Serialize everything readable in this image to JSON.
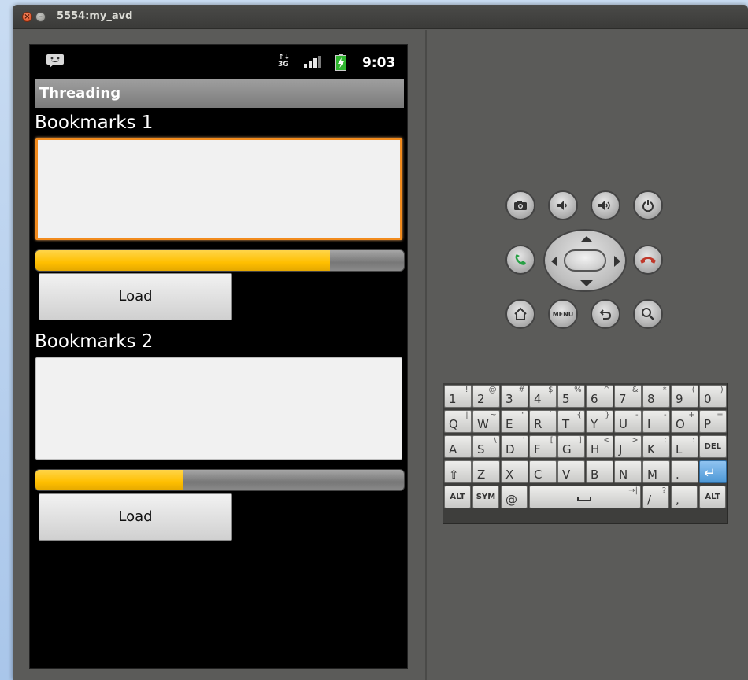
{
  "window": {
    "title": "5554:my_avd",
    "close_glyph": "×",
    "minimize_glyph": "–"
  },
  "statusbar": {
    "network": [
      "↑↓",
      "3G"
    ],
    "time": "9:03",
    "icons": [
      "message-notification-icon",
      "signal-icon",
      "battery-charging-icon"
    ]
  },
  "app": {
    "title": "Threading",
    "sections": [
      {
        "label": "Bookmarks 1",
        "text": "",
        "progress_percent": 80,
        "button_label": "Load",
        "focused": true
      },
      {
        "label": "Bookmarks 2",
        "text": "",
        "progress_percent": 40,
        "button_label": "Load",
        "focused": false
      }
    ]
  },
  "colors": {
    "focus_border": "#f28b1d",
    "progress_fill": "#ffbf00",
    "progress_track": "#888888",
    "screen_background": "#000000",
    "emulator_panel": "#5b5b59",
    "end_call": "#c0392b",
    "call": "#27a044",
    "enter_key": "#4d98d6"
  },
  "controls": {
    "row1": [
      "camera-icon",
      "volume-down-icon",
      "volume-up-icon",
      "power-icon"
    ],
    "row2": [
      "call-icon",
      "dpad",
      "end-call-icon"
    ],
    "row3": [
      "home-icon",
      "menu-button",
      "back-icon",
      "search-icon"
    ],
    "menu_label": "MENU"
  },
  "keyboard": {
    "row1": [
      {
        "k": "1",
        "a": "!"
      },
      {
        "k": "2",
        "a": "@"
      },
      {
        "k": "3",
        "a": "#"
      },
      {
        "k": "4",
        "a": "$"
      },
      {
        "k": "5",
        "a": "%"
      },
      {
        "k": "6",
        "a": "^"
      },
      {
        "k": "7",
        "a": "&"
      },
      {
        "k": "8",
        "a": "*"
      },
      {
        "k": "9",
        "a": "("
      },
      {
        "k": "0",
        "a": ")"
      }
    ],
    "row2": [
      {
        "k": "Q",
        "a": "|"
      },
      {
        "k": "W",
        "a": "~"
      },
      {
        "k": "E",
        "a": "\""
      },
      {
        "k": "R",
        "a": "`"
      },
      {
        "k": "T",
        "a": "{"
      },
      {
        "k": "Y",
        "a": "}"
      },
      {
        "k": "U",
        "a": "-"
      },
      {
        "k": "I",
        "a": "-"
      },
      {
        "k": "O",
        "a": "+"
      },
      {
        "k": "P",
        "a": "="
      }
    ],
    "row3": [
      {
        "k": "A",
        "a": ""
      },
      {
        "k": "S",
        "a": "\\"
      },
      {
        "k": "D",
        "a": "'"
      },
      {
        "k": "F",
        "a": "["
      },
      {
        "k": "G",
        "a": "]"
      },
      {
        "k": "H",
        "a": "<"
      },
      {
        "k": "J",
        "a": ">"
      },
      {
        "k": "K",
        "a": ";"
      },
      {
        "k": "L",
        "a": ":"
      },
      {
        "k": "DEL",
        "a": ""
      }
    ],
    "row4": [
      {
        "k": "⇧",
        "a": ""
      },
      {
        "k": "Z",
        "a": ""
      },
      {
        "k": "X",
        "a": ""
      },
      {
        "k": "C",
        "a": ""
      },
      {
        "k": "V",
        "a": ""
      },
      {
        "k": "B",
        "a": ""
      },
      {
        "k": "N",
        "a": ""
      },
      {
        "k": "M",
        "a": ""
      },
      {
        "k": ".",
        "a": ""
      },
      {
        "k": "↵",
        "a": ""
      }
    ],
    "row5": [
      {
        "k": "ALT",
        "a": ""
      },
      {
        "k": "SYM",
        "a": ""
      },
      {
        "k": "@",
        "a": ""
      },
      {
        "k": "SPACE",
        "a": "→|"
      },
      {
        "k": "/",
        "a": "?"
      },
      {
        "k": ",",
        "a": ""
      },
      {
        "k": "ALT",
        "a": ""
      }
    ]
  }
}
